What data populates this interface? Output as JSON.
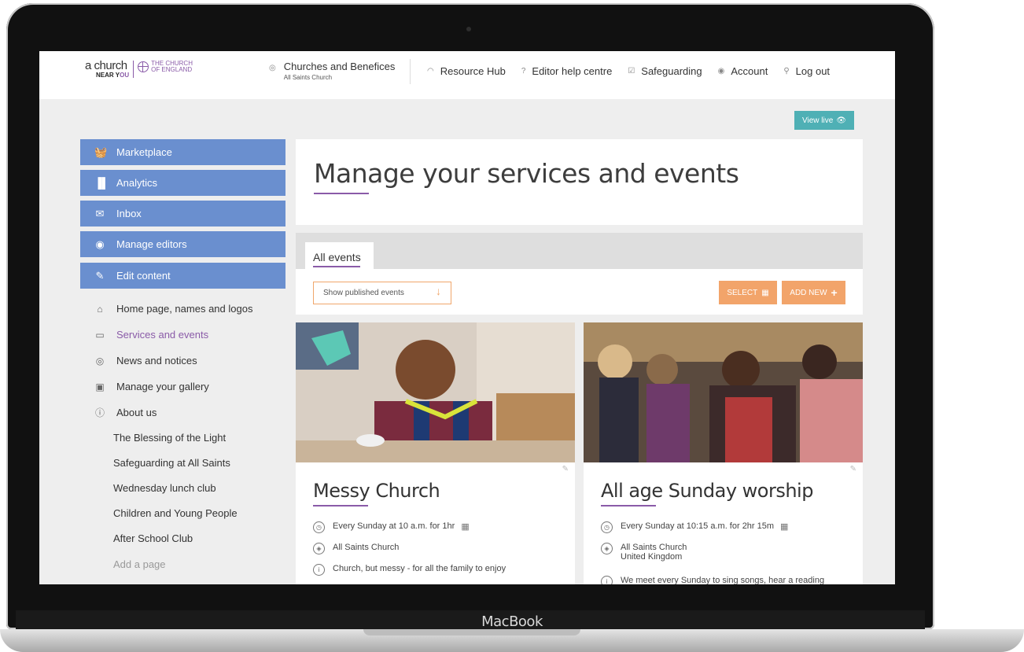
{
  "device": {
    "brand_label": "MacBook"
  },
  "header": {
    "logo": {
      "line1": "a church",
      "line2_near": "NEAR Y",
      "line2_you": "OU",
      "coe_line1": "THE CHURCH",
      "coe_line2": "OF ENGLAND"
    },
    "church_selector": {
      "title": "Churches and Benefices",
      "subtitle": "All Saints Church"
    },
    "nav": [
      {
        "label": "Resource Hub",
        "icon": "signal-icon"
      },
      {
        "label": "Editor help centre",
        "icon": "question-icon"
      },
      {
        "label": "Safeguarding",
        "icon": "check-square-icon"
      },
      {
        "label": "Account",
        "icon": "user-icon"
      },
      {
        "label": "Log out",
        "icon": "key-icon"
      }
    ],
    "view_live_label": "View live"
  },
  "sidebar": {
    "buttons": [
      {
        "label": "Marketplace",
        "icon": "basket-icon"
      },
      {
        "label": "Analytics",
        "icon": "bar-chart-icon"
      },
      {
        "label": "Inbox",
        "icon": "envelope-icon"
      },
      {
        "label": "Manage editors",
        "icon": "user-circle-icon"
      },
      {
        "label": "Edit content",
        "icon": "pencil-icon"
      }
    ],
    "sub_items": [
      {
        "label": "Home page, names and logos",
        "icon": "home-icon"
      },
      {
        "label": "Services and events",
        "icon": "calendar-icon"
      },
      {
        "label": "News and notices",
        "icon": "broadcast-icon"
      },
      {
        "label": "Manage your gallery",
        "icon": "gallery-icon"
      },
      {
        "label": "About us",
        "icon": "info-icon"
      }
    ],
    "pages": [
      "The Blessing of the Light",
      "Safeguarding at All Saints",
      "Wednesday lunch club",
      "Children and Young People",
      "After School Club"
    ],
    "add_page_label": "Add a page"
  },
  "main": {
    "title": "Manage your services and events",
    "tab_label": "All events",
    "filter_label": "Show published events",
    "select_label": "SELECT",
    "add_new_label": "ADD NEW",
    "colors": {
      "accent_purple": "#8a5ba8",
      "nav_blue": "#6a8fcf",
      "orange": "#f2a46a",
      "teal": "#4fb0b5"
    },
    "events": [
      {
        "title": "Messy Church",
        "schedule": "Every Sunday at 10 a.m. for 1hr",
        "location_lines": [
          "All Saints Church"
        ],
        "description": "Church, but messy - for all the family to enjoy"
      },
      {
        "title": "All age Sunday worship",
        "schedule": "Every Sunday at 10:15 a.m. for 2hr 15m",
        "location_lines": [
          "All Saints Church",
          "United Kingdom"
        ],
        "description": "We meet every Sunday to sing songs, hear a reading"
      }
    ]
  }
}
